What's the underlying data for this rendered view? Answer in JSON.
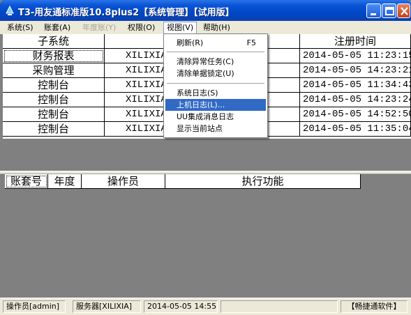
{
  "window": {
    "title": "T3-用友通标准版10.8plus2【系统管理】【试用版】"
  },
  "menubar": {
    "items": [
      {
        "label": "系统(S)"
      },
      {
        "label": "账套(A)"
      },
      {
        "label": "年度账(Y)"
      },
      {
        "label": "权限(O)"
      },
      {
        "label": "视图(V)"
      },
      {
        "label": "帮助(H)"
      }
    ]
  },
  "view_menu": {
    "items": [
      {
        "label": "刷新(R)",
        "shortcut": "F5"
      },
      {
        "label": "清除异常任务(C)",
        "shortcut": ""
      },
      {
        "label": "清除单据锁定(U)",
        "shortcut": ""
      },
      {
        "label": "系统日志(S)",
        "shortcut": ""
      },
      {
        "label": "上机日志(L)...",
        "shortcut": ""
      },
      {
        "label": "UU集成消息日志",
        "shortcut": ""
      },
      {
        "label": "显示当前站点",
        "shortcut": ""
      }
    ],
    "selected_index": 4
  },
  "subsystem_table": {
    "columns": [
      "子系统",
      "站点",
      "注册时间"
    ],
    "rows": [
      {
        "subsystem": "财务报表",
        "site": "XILIXIA",
        "time": "2014-05-05 11:23:15"
      },
      {
        "subsystem": "采购管理",
        "site": "XILIXIA",
        "time": "2014-05-05 14:23:21"
      },
      {
        "subsystem": "控制台",
        "site": "XILIXIA",
        "time": "2014-05-05 11:34:43"
      },
      {
        "subsystem": "控制台",
        "site": "XILIXIA",
        "time": "2014-05-05 14:23:24"
      },
      {
        "subsystem": "控制台",
        "site": "XILIXIA",
        "time": "2014-05-05 14:52:50"
      },
      {
        "subsystem": "控制台",
        "site": "XILIXIA",
        "time": "2014-05-05 11:35:04"
      }
    ]
  },
  "task_table": {
    "columns": [
      "账套号",
      "年度",
      "操作员",
      "执行功能"
    ]
  },
  "statusbar": {
    "operator": "操作员[admin]",
    "server": "服务器[XILIXIA]",
    "datetime": "2014-05-05 14:55",
    "brand": "【畅捷通软件】"
  }
}
